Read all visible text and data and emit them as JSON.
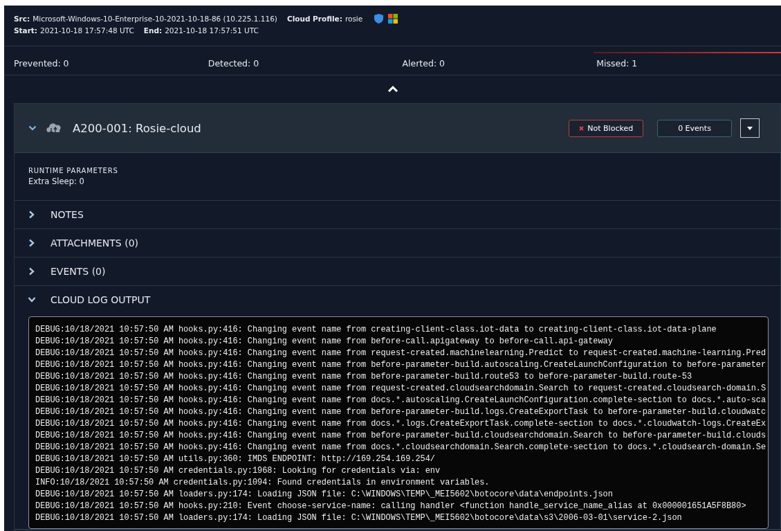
{
  "header": {
    "fields_line1": [
      {
        "label": "Src:",
        "value": "Microsoft-Windows-10-Enterprise-10-2021-10-18-86 (10.225.1.116)"
      },
      {
        "label": "Cloud Profile:",
        "value": "rosie"
      }
    ],
    "fields_line2": [
      {
        "label": "Start:",
        "value": "2021-10-18 17:57:48 UTC"
      },
      {
        "label": "End:",
        "value": "2021-10-18 17:57:51 UTC"
      }
    ]
  },
  "stats": [
    {
      "text": "Prevented: 0",
      "highlighted": false
    },
    {
      "text": "Detected: 0",
      "highlighted": false
    },
    {
      "text": "Alerted: 0",
      "highlighted": false
    },
    {
      "text": "Missed: 1",
      "highlighted": true
    }
  ],
  "action": {
    "title": "A200-001: Rosie-cloud",
    "expanded": true,
    "status": "Not Blocked",
    "events": "0 Events"
  },
  "runtime": {
    "heading": "RUNTIME PARAMETERS",
    "text": "Extra Sleep: 0"
  },
  "sections": [
    {
      "title": "NOTES",
      "expanded": false
    },
    {
      "title": "ATTACHMENTS (0)",
      "expanded": false
    },
    {
      "title": "EVENTS (0)",
      "expanded": false
    },
    {
      "title": "CLOUD LOG OUTPUT",
      "expanded": true
    }
  ],
  "log_lines": [
    "DEBUG:10/18/2021 10:57:50 AM hooks.py:416: Changing event name from creating-client-class.iot-data to creating-client-class.iot-data-plane",
    "DEBUG:10/18/2021 10:57:50 AM hooks.py:416: Changing event name from before-call.apigateway to before-call.api-gateway",
    "DEBUG:10/18/2021 10:57:50 AM hooks.py:416: Changing event name from request-created.machinelearning.Predict to request-created.machine-learning.Pred",
    "DEBUG:10/18/2021 10:57:50 AM hooks.py:416: Changing event name from before-parameter-build.autoscaling.CreateLaunchConfiguration to before-parameter",
    "DEBUG:10/18/2021 10:57:50 AM hooks.py:416: Changing event name from before-parameter-build.route53 to before-parameter-build.route-53",
    "DEBUG:10/18/2021 10:57:50 AM hooks.py:416: Changing event name from request-created.cloudsearchdomain.Search to request-created.cloudsearch-domain.S",
    "DEBUG:10/18/2021 10:57:50 AM hooks.py:416: Changing event name from docs.*.autoscaling.CreateLaunchConfiguration.complete-section to docs.*.auto-sca",
    "DEBUG:10/18/2021 10:57:50 AM hooks.py:416: Changing event name from before-parameter-build.logs.CreateExportTask to before-parameter-build.cloudwatc",
    "DEBUG:10/18/2021 10:57:50 AM hooks.py:416: Changing event name from docs.*.logs.CreateExportTask.complete-section to docs.*.cloudwatch-logs.CreateEx",
    "DEBUG:10/18/2021 10:57:50 AM hooks.py:416: Changing event name from before-parameter-build.cloudsearchdomain.Search to before-parameter-build.clouds",
    "DEBUG:10/18/2021 10:57:50 AM hooks.py:416: Changing event name from docs.*.cloudsearchdomain.Search.complete-section to docs.*.cloudsearch-domain.Se",
    "DEBUG:10/18/2021 10:57:50 AM utils.py:360: IMDS ENDPOINT: http://169.254.169.254/",
    "DEBUG:10/18/2021 10:57:50 AM credentials.py:1968: Looking for credentials via: env",
    "INFO:10/18/2021 10:57:50 AM credentials.py:1094: Found credentials in environment variables.",
    "DEBUG:10/18/2021 10:57:50 AM loaders.py:174: Loading JSON file: C:\\WINDOWS\\TEMP\\_MEI5602\\botocore\\data\\endpoints.json",
    "DEBUG:10/18/2021 10:57:50 AM hooks.py:210: Event choose-service-name: calling handler <function handle_service_name_alias at 0x000001651A5F8B80>",
    "DEBUG:10/18/2021 10:57:50 AM loaders.py:174: Loading JSON file: C:\\WINDOWS\\TEMP\\_MEI5602\\botocore\\data\\s3\\2006-03-01\\service-2.json"
  ]
}
